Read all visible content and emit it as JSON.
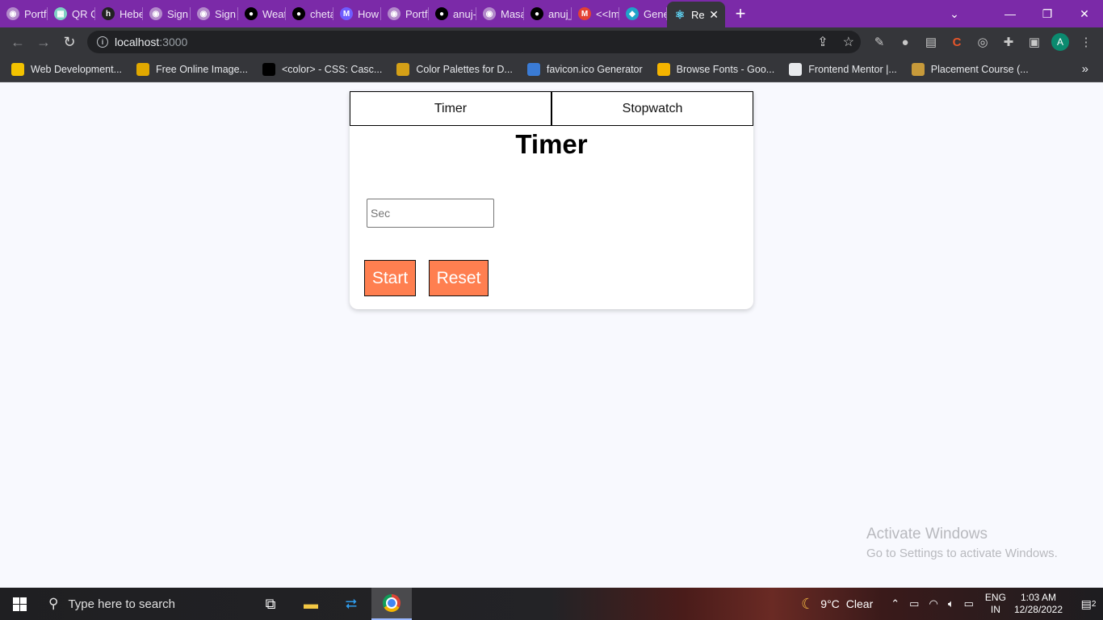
{
  "browser": {
    "tabs": [
      {
        "title": "Portfo",
        "icon": "globe-icon",
        "color": "#b38acb"
      },
      {
        "title": "QR Co",
        "icon": "qr-icon",
        "color": "#7fd0c4"
      },
      {
        "title": "Hebe",
        "icon": "h-logo-icon",
        "color": "#222222"
      },
      {
        "title": "Sign In",
        "icon": "globe-icon",
        "color": "#b38acb"
      },
      {
        "title": "Sign In",
        "icon": "globe-icon",
        "color": "#b38acb"
      },
      {
        "title": "Weath",
        "icon": "github-icon",
        "color": "#000000"
      },
      {
        "title": "chetar",
        "icon": "github-icon",
        "color": "#000000"
      },
      {
        "title": "How t",
        "icon": "mail-icon",
        "color": "#6f5cff"
      },
      {
        "title": "Portfo",
        "icon": "globe-icon",
        "color": "#b38acb"
      },
      {
        "title": "anuj-r",
        "icon": "github-icon",
        "color": "#000000"
      },
      {
        "title": "Masai",
        "icon": "globe-icon",
        "color": "#b38acb"
      },
      {
        "title": "anuj_r",
        "icon": "github-icon",
        "color": "#000000"
      },
      {
        "title": "<<Im",
        "icon": "gmail-icon",
        "color": "#e44133"
      },
      {
        "title": "Gener",
        "icon": "diamond-icon",
        "color": "#1fa3c9"
      }
    ],
    "active_tab": {
      "title": "Re",
      "icon": "react-icon",
      "close": "✕"
    },
    "new_tab": "+",
    "address": {
      "host": "localhost",
      "port": ":3000"
    },
    "profile_initial": "A",
    "bookmarks": [
      {
        "label": "Web Development...",
        "icon": "bookmark-fav-icon",
        "color": "#f2c200"
      },
      {
        "label": "Free Online Image...",
        "icon": "chrome-fav-icon",
        "color": "#e0a800"
      },
      {
        "label": "<color> - CSS: Casc...",
        "icon": "mdn-icon",
        "color": "#000000"
      },
      {
        "label": "Color Palettes for D...",
        "icon": "palette-icon",
        "color": "#d4a017"
      },
      {
        "label": "favicon.ico Generator",
        "icon": "favicon-gen-icon",
        "color": "#3a7bd5"
      },
      {
        "label": "Browse Fonts - Goo...",
        "icon": "google-fonts-icon",
        "color": "#f4b400"
      },
      {
        "label": "Frontend Mentor |...",
        "icon": "frontend-mentor-icon",
        "color": "#e8eaed"
      },
      {
        "label": "Placement Course (...",
        "icon": "placement-icon",
        "color": "#c79a3a"
      }
    ]
  },
  "app": {
    "tabs": [
      "Timer",
      "Stopwatch"
    ],
    "title": "Timer",
    "input_placeholder": "Sec",
    "start_label": "Start",
    "reset_label": "Reset",
    "accent": "#ff7f50"
  },
  "watermark": {
    "line1": "Activate Windows",
    "line2": "Go to Settings to activate Windows."
  },
  "taskbar": {
    "search_placeholder": "Type here to search",
    "weather": {
      "temp": "9°C",
      "condition": "Clear"
    },
    "lang": {
      "l1": "ENG",
      "l2": "IN"
    },
    "clock": {
      "time": "1:03 AM",
      "date": "12/28/2022"
    },
    "notifications": "2"
  }
}
